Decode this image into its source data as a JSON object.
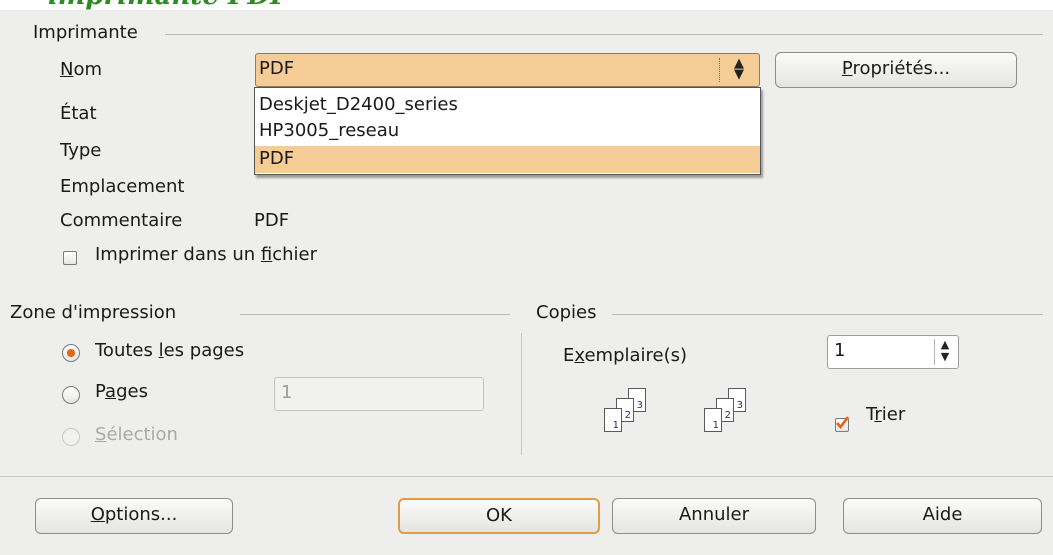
{
  "background_title": "imprimante PDF",
  "printer": {
    "frame_title": "Imprimante",
    "name_label": "Nom",
    "selected": "PDF",
    "options": [
      "Deskjet_D2400_series",
      "HP3005_reseau",
      "PDF"
    ],
    "properties_button": "Propriétés...",
    "state_label": "État",
    "type_label": "Type",
    "location_label": "Emplacement",
    "comment_label": "Commentaire",
    "comment_value": "PDF",
    "print_to_file_label": "Imprimer dans un fichier",
    "print_to_file_checked": false
  },
  "print_range": {
    "frame_title": "Zone d'impression",
    "all_pages_label": "Toutes les pages",
    "pages_label": "Pages",
    "pages_value": "1",
    "selection_label": "Sélection",
    "selected": "all"
  },
  "copies": {
    "frame_title": "Copies",
    "copies_label": "Exemplaire(s)",
    "copies_value": "1",
    "collate_label": "Trier",
    "collate_checked": true,
    "page_numbers": [
      "1",
      "2",
      "3"
    ]
  },
  "buttons": {
    "options": "Options...",
    "ok": "OK",
    "cancel": "Annuler",
    "help": "Aide"
  },
  "colors": {
    "accent": "#f6cc96",
    "radio_dot": "#e8621a",
    "default_button_border": "#e39a4a",
    "background_title": "#2f8a23"
  }
}
